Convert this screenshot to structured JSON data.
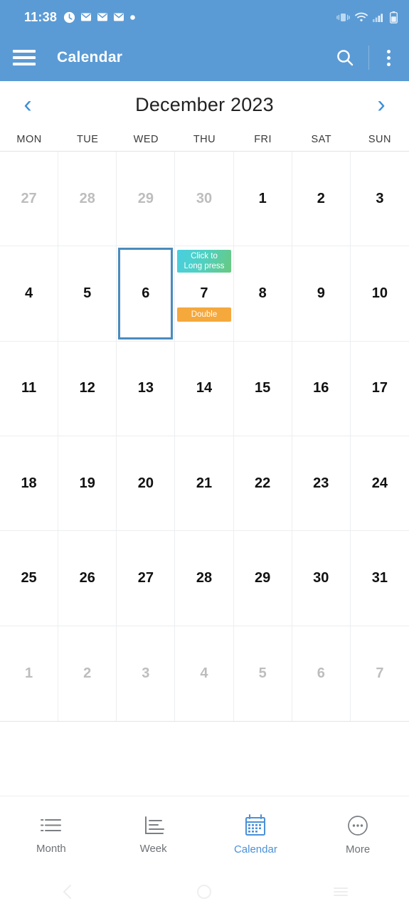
{
  "statusbar": {
    "time": "11:38",
    "left_icons": [
      "alarm-clock-icon",
      "mail-icon",
      "mail-icon",
      "mail-icon",
      "dot-icon"
    ],
    "right_icons": [
      "vibrate-icon",
      "wifi-icon",
      "cellular-signal-icon",
      "battery-icon"
    ]
  },
  "appbar": {
    "menu_icon": "hamburger-menu-icon",
    "title": "Calendar",
    "search_icon": "search-icon",
    "overflow_icon": "kebab-menu-icon"
  },
  "monthbar": {
    "prev_label": "‹",
    "title": "December 2023",
    "next_label": "›"
  },
  "weekdays": [
    "MON",
    "TUE",
    "WED",
    "THU",
    "FRI",
    "SAT",
    "SUN"
  ],
  "calendar": {
    "weeks": [
      [
        {
          "day": "27",
          "out": true
        },
        {
          "day": "28",
          "out": true
        },
        {
          "day": "29",
          "out": true
        },
        {
          "day": "30",
          "out": true
        },
        {
          "day": "1",
          "out": false
        },
        {
          "day": "2",
          "out": false
        },
        {
          "day": "3",
          "out": false
        }
      ],
      [
        {
          "day": "4",
          "out": false
        },
        {
          "day": "5",
          "out": false
        },
        {
          "day": "6",
          "out": false,
          "selected": true
        },
        {
          "day": "7",
          "out": false,
          "chip_top": "Click to\nLong press",
          "chip_bottom": "Double"
        },
        {
          "day": "8",
          "out": false
        },
        {
          "day": "9",
          "out": false
        },
        {
          "day": "10",
          "out": false
        }
      ],
      [
        {
          "day": "11",
          "out": false
        },
        {
          "day": "12",
          "out": false
        },
        {
          "day": "13",
          "out": false
        },
        {
          "day": "14",
          "out": false
        },
        {
          "day": "15",
          "out": false
        },
        {
          "day": "16",
          "out": false
        },
        {
          "day": "17",
          "out": false
        }
      ],
      [
        {
          "day": "18",
          "out": false
        },
        {
          "day": "19",
          "out": false
        },
        {
          "day": "20",
          "out": false
        },
        {
          "day": "21",
          "out": false
        },
        {
          "day": "22",
          "out": false
        },
        {
          "day": "23",
          "out": false
        },
        {
          "day": "24",
          "out": false
        }
      ],
      [
        {
          "day": "25",
          "out": false
        },
        {
          "day": "26",
          "out": false
        },
        {
          "day": "27",
          "out": false
        },
        {
          "day": "28",
          "out": false
        },
        {
          "day": "29",
          "out": false
        },
        {
          "day": "30",
          "out": false
        },
        {
          "day": "31",
          "out": false
        }
      ],
      [
        {
          "day": "1",
          "out": true
        },
        {
          "day": "2",
          "out": true
        },
        {
          "day": "3",
          "out": true
        },
        {
          "day": "4",
          "out": true
        },
        {
          "day": "5",
          "out": true
        },
        {
          "day": "6",
          "out": true
        },
        {
          "day": "7",
          "out": true
        }
      ]
    ]
  },
  "bottomnav": {
    "items": [
      {
        "label": "Month",
        "icon": "list-icon",
        "active": false
      },
      {
        "label": "Week",
        "icon": "bar-chart-icon",
        "active": false
      },
      {
        "label": "Calendar",
        "icon": "calendar-icon",
        "active": true
      },
      {
        "label": "More",
        "icon": "more-circle-icon",
        "active": false
      }
    ]
  },
  "sysbar": {
    "back_icon": "back-chevron-icon",
    "home_icon": "home-circle-icon",
    "recents_icon": "recents-lines-icon"
  },
  "colors": {
    "brand_blue": "#5b9bd5",
    "accent_blue": "#4a90d9",
    "selection_border": "#4a8bbd",
    "chip_gradient_from": "#49cfe0",
    "chip_gradient_to": "#69c97f",
    "chip_orange": "#f5a83c",
    "out_of_month_text": "#bdbdbd",
    "in_month_text": "#111111"
  }
}
